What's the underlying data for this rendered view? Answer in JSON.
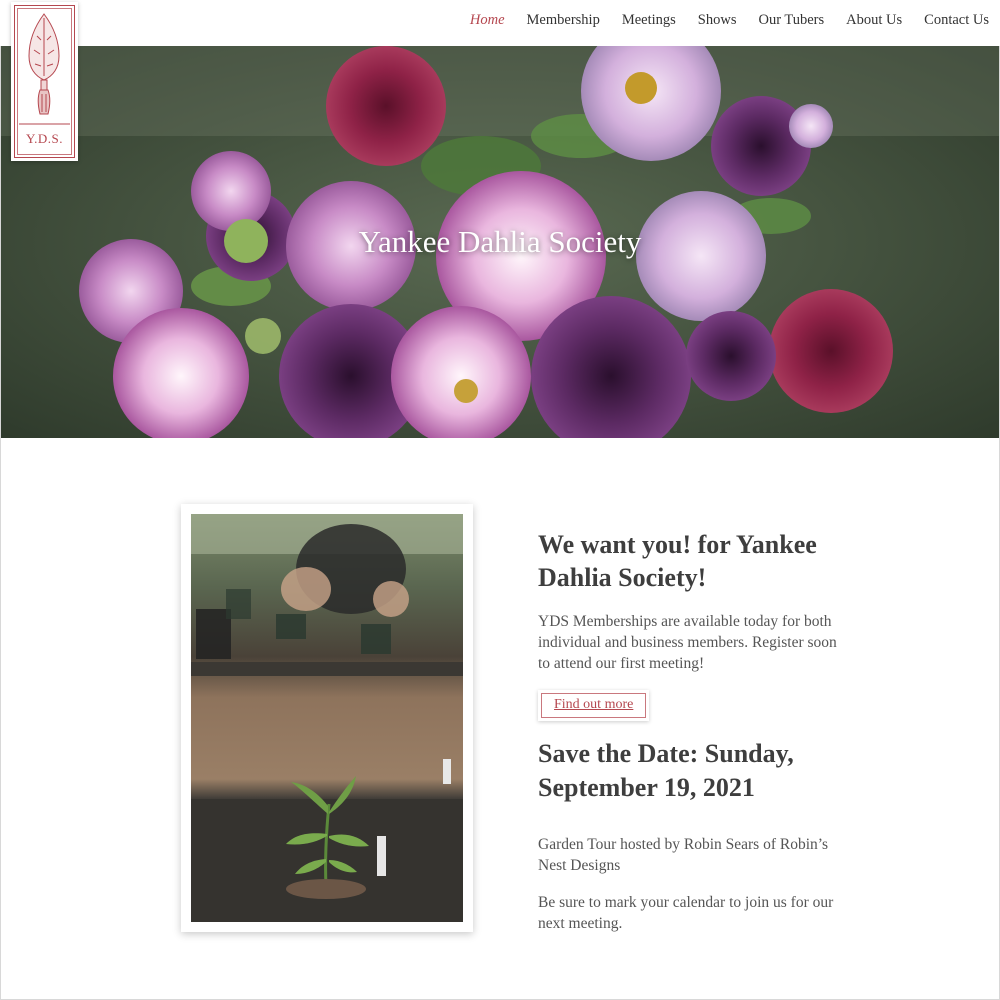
{
  "site": {
    "logo_text": "Y.D.S."
  },
  "nav": {
    "items": [
      {
        "label": "Home",
        "active": true
      },
      {
        "label": "Membership",
        "active": false
      },
      {
        "label": "Meetings",
        "active": false
      },
      {
        "label": "Shows",
        "active": false
      },
      {
        "label": "Our Tubers",
        "active": false
      },
      {
        "label": "About Us",
        "active": false
      },
      {
        "label": "Contact Us",
        "active": false
      }
    ]
  },
  "hero": {
    "title": "Yankee Dahlia Society"
  },
  "main": {
    "headline_bold": "We want you!",
    "headline_rest": " for Yankee Dahlia Society!",
    "membership_text": "YDS Memberships are available today for both individual and business members. Register soon to attend our first meeting!",
    "button_label": "Find out more",
    "date_headline": "Save the Date: Sunday, September 19, 2021",
    "tour_text": "Garden Tour hosted by Robin Sears of Robin’s Nest Designs",
    "calendar_text": "Be sure to mark your calendar to join us for our next meeting."
  },
  "colors": {
    "accent": "#b5474f",
    "text": "#444444"
  }
}
